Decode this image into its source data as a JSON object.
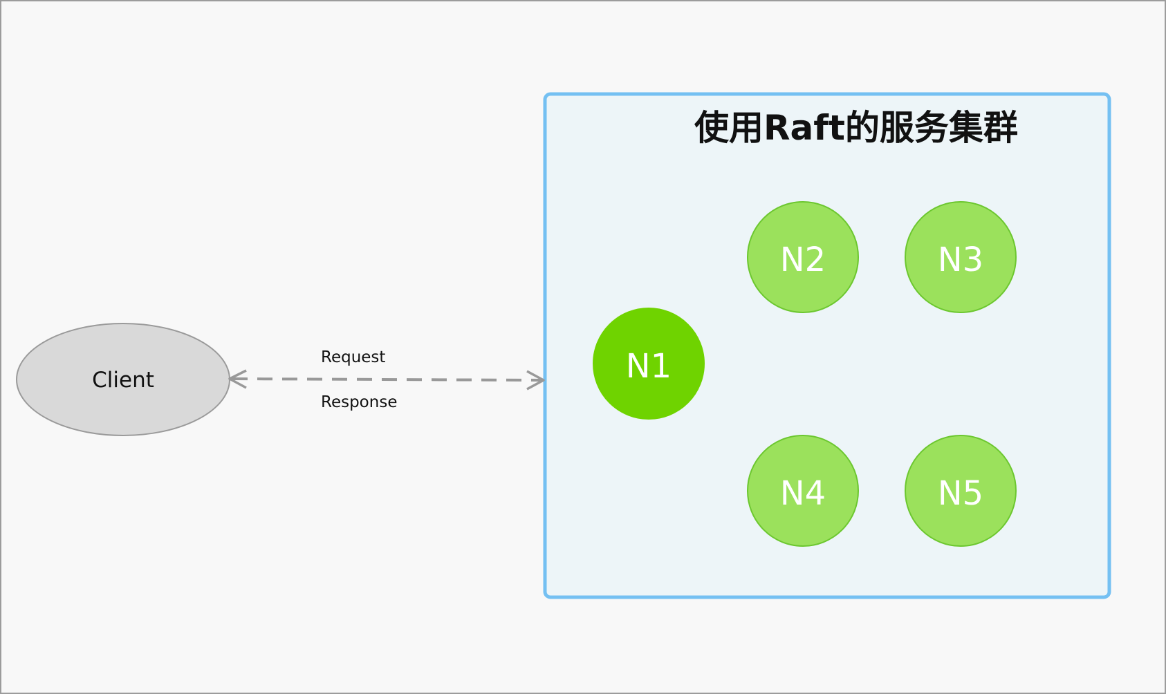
{
  "cluster": {
    "title": "使用Raft的服务集群",
    "fill": "#edf5f8",
    "border_color": "#74c0f2"
  },
  "client": {
    "label": "Client",
    "fill": "#d9d9d9",
    "border_color": "#9a9a9a"
  },
  "connection": {
    "request_label": "Request",
    "response_label": "Response",
    "line_color": "#999999",
    "style": "dashed",
    "direction": "bidirectional"
  },
  "nodes": [
    {
      "label": "N1",
      "role": "leader",
      "fill": "#6fd300",
      "border_color": "#6fd300"
    },
    {
      "label": "N2",
      "role": "follower",
      "fill": "#9be15c",
      "border_color": "#6cc72f"
    },
    {
      "label": "N3",
      "role": "follower",
      "fill": "#9be15c",
      "border_color": "#6cc72f"
    },
    {
      "label": "N4",
      "role": "follower",
      "fill": "#9be15c",
      "border_color": "#6cc72f"
    },
    {
      "label": "N5",
      "role": "follower",
      "fill": "#9be15c",
      "border_color": "#6cc72f"
    }
  ]
}
